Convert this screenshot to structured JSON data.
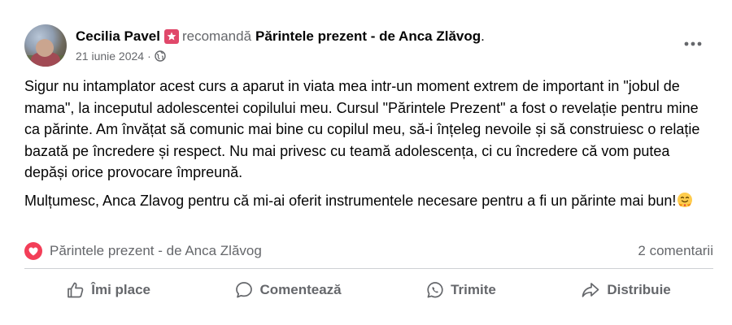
{
  "post": {
    "author": "Cecilia Pavel",
    "recommends_text": "recomandă",
    "page_name": "Părintele prezent - de Anca Zlăvog",
    "end_punct": ".",
    "date": "21 iunie 2024",
    "separator": "·",
    "privacy_icon": "globe-icon",
    "paragraph_1": "Sigur nu intamplator acest curs a aparut in viata mea intr-un moment extrem de important in \"jobul de mama\", la inceputul adolescentei copilului meu. Cursul \"Părintele Prezent\" a fost o revelație pentru mine ca părinte. Am învățat să comunic mai bine cu copilul meu, să-i înțeleg nevoile și să construiesc o relație bazată pe încredere și respect. Nu mai privesc cu teamă adolescența, ci cu încredere că vom putea depăși orice provocare împreună.",
    "paragraph_2": "Mulțumesc, Anca Zlavog pentru că mi-ai oferit instrumentele necesare pentru a fi un părinte mai bun!",
    "emoji": "smiling-face-with-hearts-hands-emoji"
  },
  "reactions": {
    "icon": "love-reaction-icon",
    "label": "Părintele prezent - de Anca Zlăvog",
    "comments": "2 comentarii"
  },
  "actions": {
    "like": "Îmi place",
    "comment": "Comentează",
    "send": "Trimite",
    "share": "Distribuie"
  },
  "colors": {
    "text_primary": "#050505",
    "text_secondary": "#65676b",
    "recommend_badge": "#e0486a",
    "love_reaction": "#f33e58",
    "divider": "#ced0d4"
  }
}
